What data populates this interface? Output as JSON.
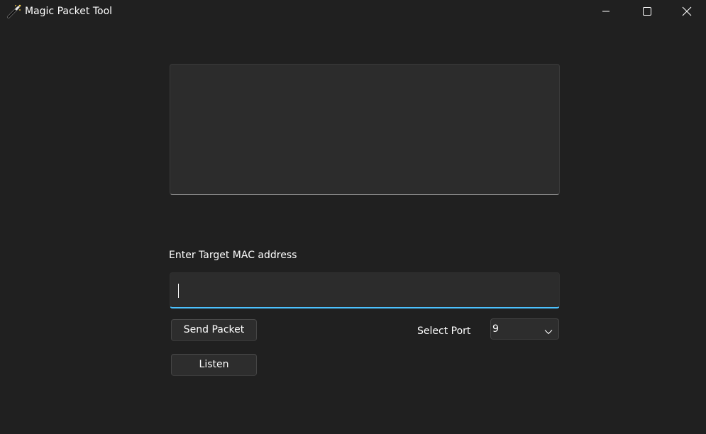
{
  "window": {
    "title": "Magic Packet Tool",
    "icon": "magic-wand-icon",
    "controls": {
      "minimize": "minimize-icon",
      "maximize": "maximize-icon",
      "close": "close-icon"
    }
  },
  "output": {
    "text": ""
  },
  "mac": {
    "label": "Enter Target MAC address",
    "value": "",
    "placeholder": ""
  },
  "actions": {
    "send_label": "Send Packet",
    "listen_label": "Listen"
  },
  "port": {
    "label": "Select Port",
    "selected": "9"
  },
  "colors": {
    "background": "#202020",
    "control": "#2d2d2d",
    "accent": "#4cc2ff",
    "text": "#ffffff"
  }
}
